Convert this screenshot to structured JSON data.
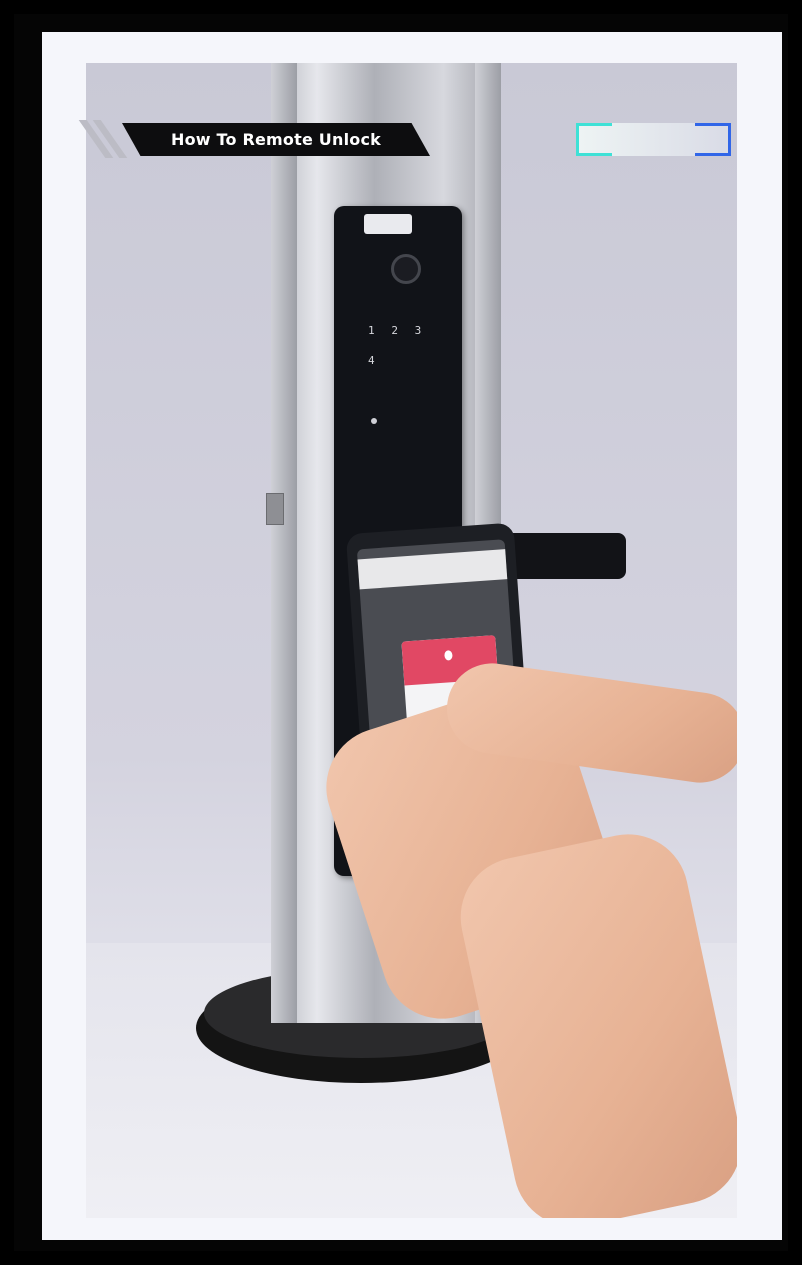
{
  "overlay": {
    "title": "How To Remote Unlock"
  },
  "lock": {
    "keypad_keys": [
      "1",
      "2",
      "3",
      "4",
      "",
      ""
    ]
  },
  "colors": {
    "banner_bg": "#0d0d0f",
    "banner_text": "#ffffff",
    "dialog_accent": "#e14864",
    "logo_accent_left": "#3ee1d6",
    "logo_accent_right": "#3166e8"
  }
}
